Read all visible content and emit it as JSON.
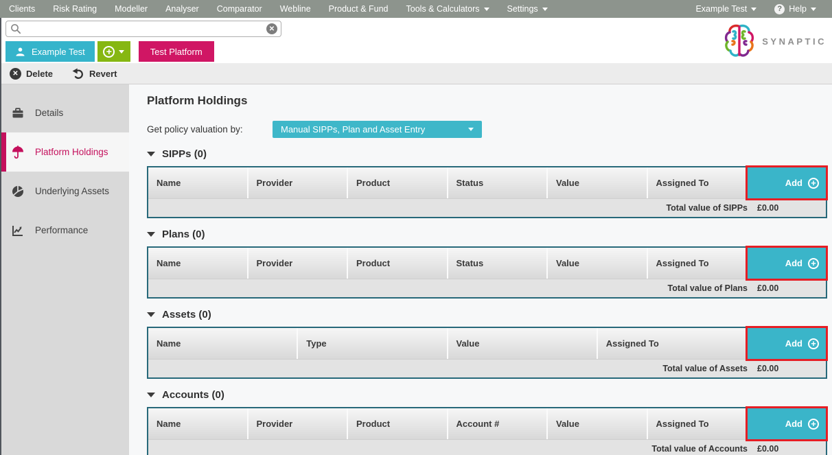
{
  "topbar": {
    "items": [
      {
        "label": "Clients"
      },
      {
        "label": "Risk Rating"
      },
      {
        "label": "Modeller"
      },
      {
        "label": "Analyser"
      },
      {
        "label": "Comparator"
      },
      {
        "label": "Webline"
      },
      {
        "label": "Product & Fund"
      },
      {
        "label": "Tools & Calculators",
        "caret": true
      },
      {
        "label": "Settings",
        "caret": true
      }
    ],
    "user_menu": "Example Test",
    "help_label": "Help"
  },
  "search": {
    "value": "",
    "placeholder": ""
  },
  "brand": "SYNAPTIC",
  "tabs": {
    "client": "Example Test",
    "platform": "Test Platform"
  },
  "toolbar": {
    "delete_label": "Delete",
    "revert_label": "Revert"
  },
  "sidebar": {
    "items": [
      {
        "label": "Details",
        "icon": "briefcase-icon",
        "active": false
      },
      {
        "label": "Platform Holdings",
        "icon": "umbrella-icon",
        "active": true
      },
      {
        "label": "Underlying Assets",
        "icon": "pie-chart-icon",
        "active": false
      },
      {
        "label": "Performance",
        "icon": "performance-chart-icon",
        "active": false
      }
    ]
  },
  "main": {
    "title": "Platform Holdings",
    "valuation_label": "Get policy valuation by:",
    "valuation_value": "Manual SIPPs, Plan and Asset Entry",
    "sections": [
      {
        "title": "SIPPs (0)",
        "columns": [
          "Name",
          "Provider",
          "Product",
          "Status",
          "Value",
          "Assigned To"
        ],
        "add_label": "Add",
        "total_label": "Total value of SIPPs",
        "total_value": "£0.00"
      },
      {
        "title": "Plans (0)",
        "columns": [
          "Name",
          "Provider",
          "Product",
          "Status",
          "Value",
          "Assigned To"
        ],
        "add_label": "Add",
        "total_label": "Total value of Plans",
        "total_value": "£0.00"
      },
      {
        "title": "Assets (0)",
        "columns": [
          "Name",
          "Type",
          "Value",
          "Assigned To"
        ],
        "add_label": "Add",
        "total_label": "Total value of Assets",
        "total_value": "£0.00"
      },
      {
        "title": "Accounts (0)",
        "columns": [
          "Name",
          "Provider",
          "Product",
          "Account #",
          "Value",
          "Assigned To"
        ],
        "add_label": "Add",
        "total_label": "Total value of Accounts",
        "total_value": "£0.00"
      }
    ]
  },
  "colors": {
    "topbar": "#8d948d",
    "teal": "#3ab5c9",
    "green": "#86b712",
    "magenta": "#d01664",
    "sidebar_accent": "#c4105c",
    "table_border": "#27697a",
    "highlight_red": "#e61e25"
  }
}
